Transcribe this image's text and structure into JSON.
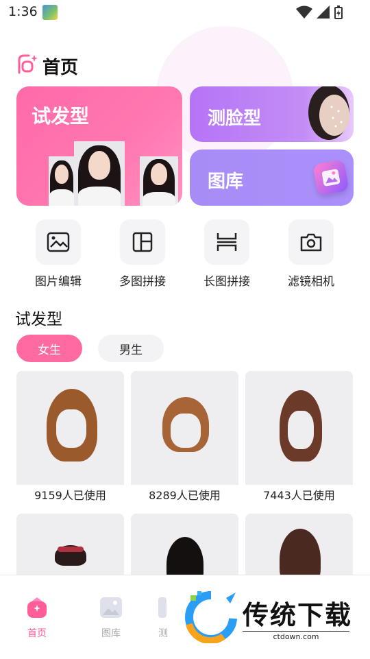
{
  "status_bar": {
    "time": "1:36"
  },
  "header": {
    "title": "首页"
  },
  "cards": {
    "hair": {
      "title": "试发型"
    },
    "face": {
      "title": "测脸型"
    },
    "gallery": {
      "title": "图库"
    }
  },
  "tools": [
    {
      "label": "图片编辑",
      "icon": "image-edit-icon"
    },
    {
      "label": "多图拼接",
      "icon": "grid-collage-icon"
    },
    {
      "label": "长图拼接",
      "icon": "long-collage-icon"
    },
    {
      "label": "滤镜相机",
      "icon": "camera-icon"
    }
  ],
  "section": {
    "title": "试发型"
  },
  "filters": {
    "female": "女生",
    "male": "男生",
    "selected": "女生"
  },
  "hairstyles": [
    {
      "usage": "9159人已使用",
      "color": "#9b5a2b"
    },
    {
      "usage": "8289人已使用",
      "color": "#a76436"
    },
    {
      "usage": "7443人已使用",
      "color": "#6b3a28"
    },
    {
      "usage": "",
      "color": "#2a1a1a"
    },
    {
      "usage": "",
      "color": "#151010"
    },
    {
      "usage": "",
      "color": "#4a2a20"
    }
  ],
  "tab_bar": [
    {
      "label": "首页",
      "active": true
    },
    {
      "label": "图库",
      "active": false
    },
    {
      "label": "测",
      "active": false
    }
  ],
  "watermark": {
    "text": "传统下载",
    "url": "ctdown.com"
  },
  "colors": {
    "accent": "#ff6aa3",
    "purple": "#b674f7"
  }
}
